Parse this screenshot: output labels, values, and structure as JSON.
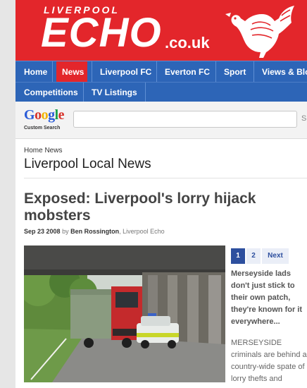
{
  "brand": {
    "top": "LIVERPOOL",
    "main": "ECHO",
    "tld": ".co.uk"
  },
  "nav": {
    "primary": [
      "Home",
      "News",
      "Liverpool FC",
      "Everton FC",
      "Sport",
      "Views & Blo"
    ],
    "active": "News",
    "secondary": [
      "Competitions",
      "TV Listings"
    ]
  },
  "search": {
    "logo_word": "Google",
    "logo_sub": "Custom Search",
    "value": "",
    "button_stub": "S"
  },
  "page": {
    "breadcrumb": "Home News",
    "section_title": "Liverpool Local News"
  },
  "article": {
    "headline": "Exposed: Liverpool's lorry hijack mobsters",
    "date": "Sep 23 2008",
    "by": "by",
    "author": "Ben Rossington",
    "publication": ", Liverpool Echo",
    "pager": [
      "1",
      "2",
      "Next"
    ],
    "teaser": "Merseyside lads don't just stick to their own patch, they're known for it everywhere...",
    "body": "MERSEYSIDE criminals are behind a country-wide spate of lorry thefts and"
  },
  "colors": {
    "brand_red": "#e3262b",
    "nav_blue": "#2d65b7",
    "pager_blue": "#2d4f9e"
  }
}
